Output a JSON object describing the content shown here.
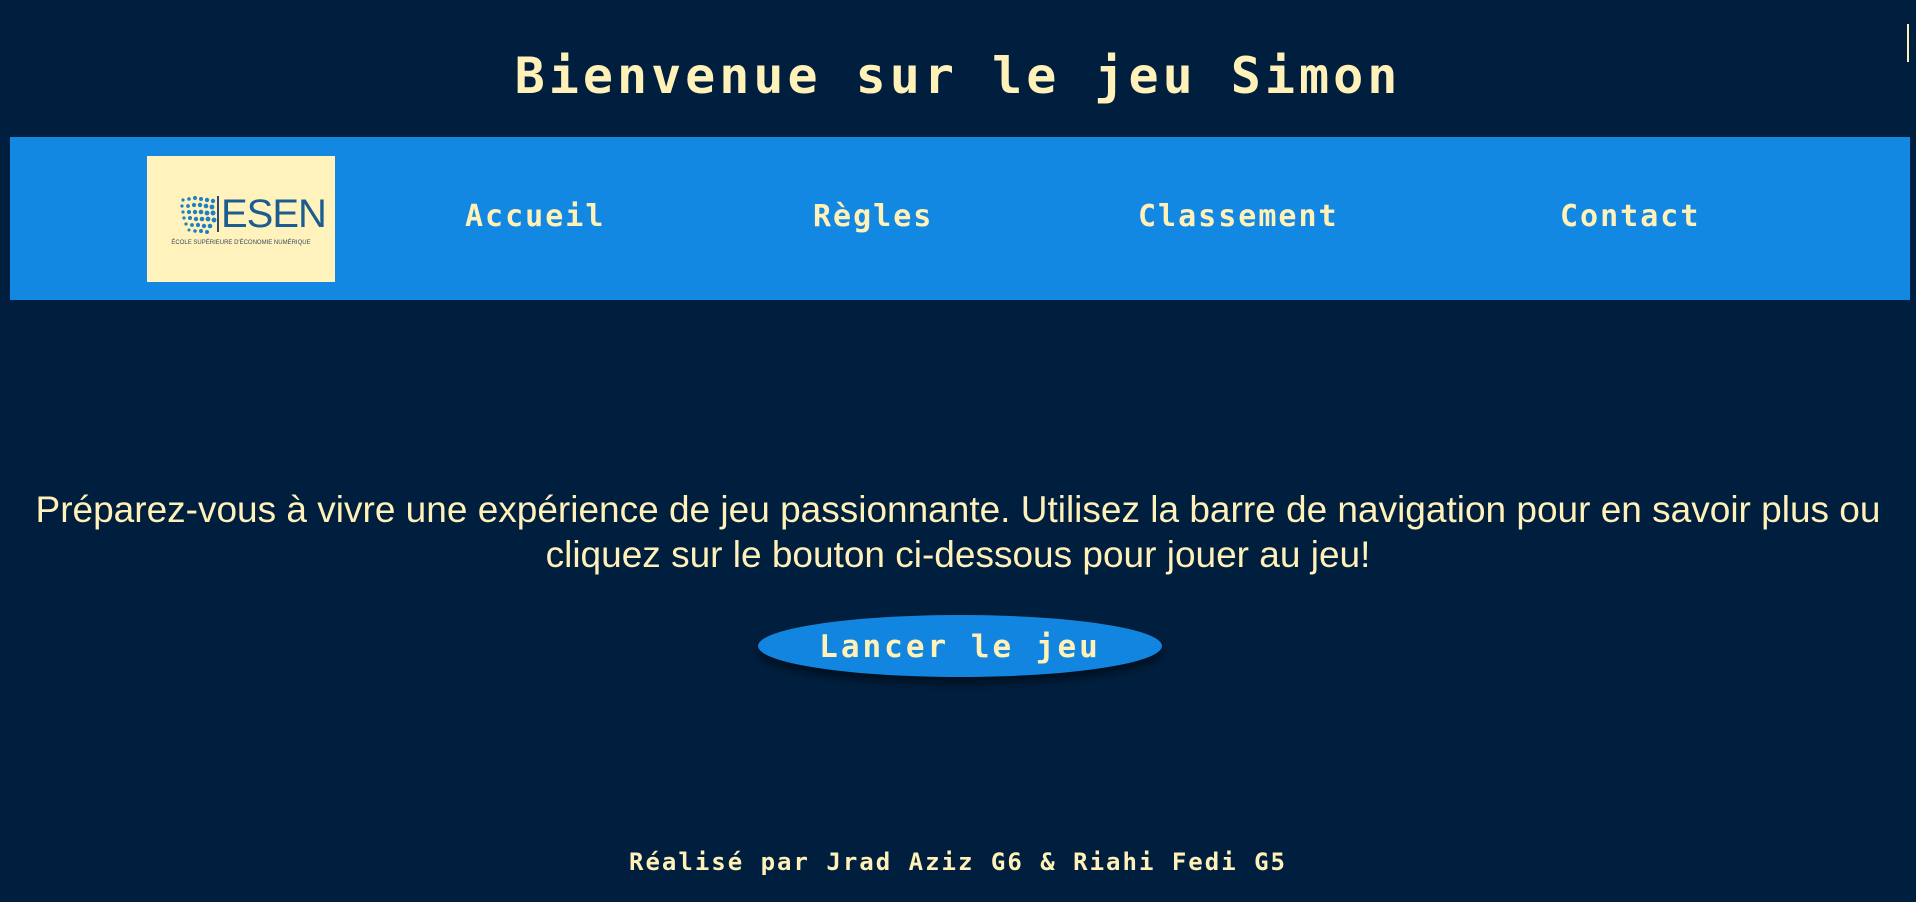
{
  "header": {
    "title": "Bienvenue sur le jeu Simon"
  },
  "nav": {
    "logo": {
      "text": "ESEN",
      "subtitle": "ÉCOLE SUPÉRIEURE D'ÉCONOMIE NUMÉRIQUE"
    },
    "items": [
      {
        "label": "Accueil"
      },
      {
        "label": "Règles"
      },
      {
        "label": "Classement"
      },
      {
        "label": "Contact"
      }
    ]
  },
  "main": {
    "intro": "Préparez-vous à vivre une expérience de jeu passionnante. Utilisez la barre de navigation pour en savoir plus ou cliquez sur le bouton ci-dessous pour jouer au jeu!",
    "launch_button": "Lancer le jeu"
  },
  "footer": {
    "credit": "Réalisé par Jrad Aziz G6 & Riahi Fedi G5"
  },
  "colors": {
    "background": "#001f3f",
    "navbar": "#1288e3",
    "text": "#fff1b8",
    "button": "#1285e0",
    "logo_background": "#fff2bd"
  }
}
